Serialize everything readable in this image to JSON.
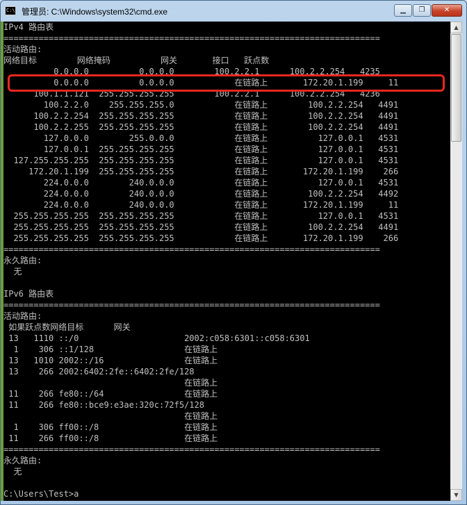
{
  "window": {
    "title": "管理员: C:\\Windows\\system32\\cmd.exe",
    "app_icon_text": "C:\\",
    "buttons": {
      "minimize": "▁",
      "maximize": "❐",
      "close": "✕"
    }
  },
  "scrollbar": {
    "up": "▲",
    "down": "▼"
  },
  "console": {
    "lines": [
      "IPv4 路由表",
      "===========================================================================",
      "活动路由:",
      "网络目标        网络掩码          网关       接口   跃点数",
      "          0.0.0.0          0.0.0.0        100.2.2.1      100.2.2.254   4235",
      "          0.0.0.0          0.0.0.0            在链路上       172.20.1.199     11",
      "      100.1.1.121  255.255.255.255        100.2.2.1      100.2.2.254   4236",
      "        100.2.2.0    255.255.255.0            在链路上        100.2.2.254   4491",
      "      100.2.2.254  255.255.255.255            在链路上        100.2.2.254   4491",
      "      100.2.2.255  255.255.255.255            在链路上        100.2.2.254   4491",
      "        127.0.0.0        255.0.0.0            在链路上          127.0.0.1   4531",
      "        127.0.0.1  255.255.255.255            在链路上          127.0.0.1   4531",
      "  127.255.255.255  255.255.255.255            在链路上          127.0.0.1   4531",
      "     172.20.1.199  255.255.255.255            在链路上       172.20.1.199    266",
      "        224.0.0.0        240.0.0.0            在链路上          127.0.0.1   4531",
      "        224.0.0.0        240.0.0.0            在链路上        100.2.2.254   4492",
      "        224.0.0.0        240.0.0.0            在链路上       172.20.1.199     11",
      "  255.255.255.255  255.255.255.255            在链路上          127.0.0.1   4531",
      "  255.255.255.255  255.255.255.255            在链路上        100.2.2.254   4491",
      "  255.255.255.255  255.255.255.255            在链路上       172.20.1.199    266",
      "===========================================================================",
      "永久路由:",
      "  无",
      "",
      "IPv6 路由表",
      "===========================================================================",
      "活动路由:",
      " 如果跃点数网络目标      网关",
      " 13   1110 ::/0                     2002:c058:6301::c058:6301",
      "  1    306 ::1/128                  在链路上",
      " 13   1010 2002::/16                在链路上",
      " 13    266 2002:6402:2fe::6402:2fe/128",
      "                                    在链路上",
      " 11    266 fe80::/64                在链路上",
      " 11    266 fe80::bce9:e3ae:320c:72f5/128",
      "                                    在链路上",
      "  1    306 ff00::/8                 在链路上",
      " 11    266 ff00::/8                 在链路上",
      "===========================================================================",
      "永久路由:",
      "  无",
      "",
      "C:\\Users\\Test>a"
    ]
  }
}
